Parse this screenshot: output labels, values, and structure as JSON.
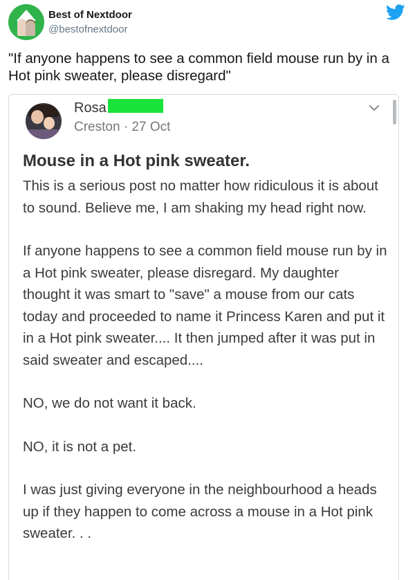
{
  "tweet": {
    "display_name": "Best of Nextdoor",
    "handle": "@bestofnextdoor",
    "text": "\"If anyone happens to see a common field mouse run by in a Hot pink sweater, please disregard\"",
    "avatar_icon": "best-of-nextdoor-logo",
    "brand_icon": "twitter-bird",
    "brand_color": "#1da1f2",
    "avatar_color": "#2fb34a"
  },
  "post": {
    "author_name": "Rosa",
    "location": "Creston",
    "separator": "·",
    "date": "27 Oct",
    "menu_icon": "chevron-down",
    "title": "Mouse in a Hot pink sweater.",
    "paragraphs": [
      "This is a serious post no matter how ridiculous it is about to sound. Believe me, I am shaking my head right now.",
      "If anyone happens to see a common field mouse run by in a Hot pink sweater, please disregard. My daughter thought it was smart to \"save\" a mouse from our cats today and proceeded to name it Princess Karen and put it in a Hot pink sweater.... It then jumped after it was put in said sweater and escaped....",
      "NO, we do not want it back.",
      "NO, it is not a pet.",
      "I was just giving everyone in the neighbourhood a heads up if they happen to come across a mouse in a Hot pink sweater. . ."
    ],
    "redaction_color": "#19e23a"
  }
}
